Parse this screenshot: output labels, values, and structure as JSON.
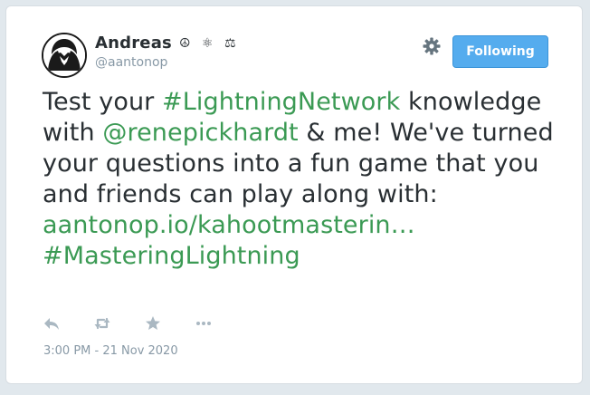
{
  "user": {
    "display_name": "Andreas",
    "name_symbols": "☮ ⚛ ⚖",
    "handle": "@aantonop"
  },
  "follow_button": {
    "label": "Following"
  },
  "icons": {
    "settings": "gear-icon",
    "reply": "reply-icon",
    "retweet": "retweet-icon",
    "favorite": "star-icon",
    "more": "more-icon"
  },
  "tweet": {
    "segments": [
      {
        "text": "Test your ",
        "type": "text"
      },
      {
        "text": "#LightningNetwork",
        "type": "hashtag"
      },
      {
        "text": " knowledge with ",
        "type": "text"
      },
      {
        "text": "@renepickhardt",
        "type": "mention"
      },
      {
        "text": " & me! We've turned your questions into a fun game that you and friends can play along with: ",
        "type": "text"
      },
      {
        "text": "aantonop.io/kahootmasterin…",
        "type": "url"
      },
      {
        "text": " ",
        "type": "text"
      },
      {
        "text": "#MasteringLightning",
        "type": "hashtag"
      }
    ],
    "timestamp": "3:00 PM - 21 Nov 2020"
  },
  "colors": {
    "link": "#3b9a54",
    "button": "#55acee",
    "text": "#292f33",
    "muted": "#8899a6",
    "icon": "#aab8c2"
  }
}
